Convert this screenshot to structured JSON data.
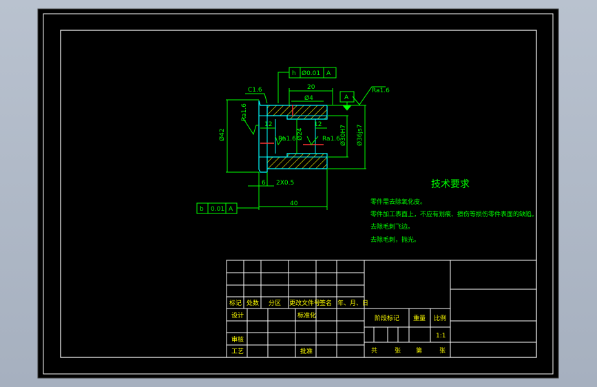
{
  "colors": {
    "viewport_bg": "#b3bcc9",
    "paper": "#000000",
    "border": "#ffffff",
    "geometry": "#00ffff",
    "dimension": "#00ff00",
    "hatch": "#ffff00",
    "centerline": "#ff3333",
    "text": "#00ff00",
    "title_text": "#ffff00"
  },
  "drawing": {
    "datum_a": "A",
    "datum_b": "b",
    "fcf_top": {
      "symbol": "h",
      "tolerance": "Ø0.01",
      "datum": "A"
    },
    "fcf_bottom": {
      "symbol": "b",
      "tolerance": "0.01",
      "datum": "A"
    },
    "chamfer": "C1.6",
    "roughness_left": "Ra1.6",
    "roughness_right": "Ra1.6",
    "roughness_bore_left": "Ra1.6",
    "roughness_bore_right": "Ra1.6",
    "dim_20": "20",
    "dim_4": "Ø4",
    "dim_12_left": "12",
    "dim_12_right": "12",
    "dim_42": "Ø42",
    "dim_24": "Ø24",
    "dim_30h7": "Ø30H7",
    "dim_36js7": "Ø36js7",
    "dim_6": "6",
    "dim_chamfer2": "2X0.5",
    "dim_40": "40"
  },
  "tech_req": {
    "title": "技术要求",
    "lines": [
      "零件需去除氧化皮。",
      "零件加工表面上，不应有划痕、擦伤等损伤零件表面的缺陷。",
      "去除毛刺飞边。",
      "去除毛刺，抛光。"
    ]
  },
  "title_block": {
    "row_labels": [
      "标记",
      "处数",
      "分区",
      "更改文件号",
      "签名",
      "年、月、日"
    ],
    "design": "设计",
    "standardize": "标准化",
    "review": "审核",
    "process": "工艺",
    "approve": "批准",
    "stage_mark": "阶段标记",
    "weight": "重量",
    "scale_label": "比例",
    "scale_value": "1:1",
    "total": "共",
    "sheets": "张",
    "sheet_no": "第",
    "sheet_suffix": "张"
  }
}
